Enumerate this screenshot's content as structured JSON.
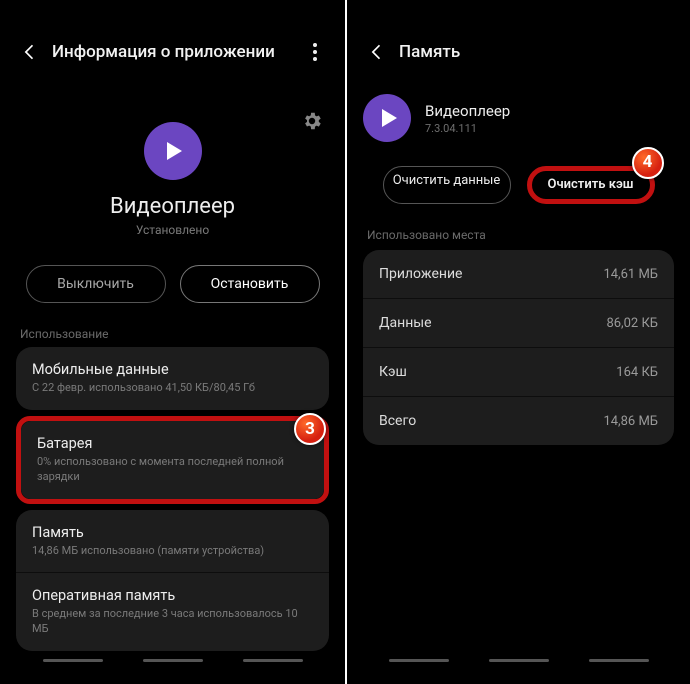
{
  "left": {
    "header_title": "Информация о приложении",
    "app_name": "Видеоплеер",
    "app_status": "Установлено",
    "btn_disable": "Выключить",
    "btn_stop": "Остановить",
    "section_usage": "Использование",
    "items": [
      {
        "title": "Мобильные данные",
        "sub": "С 22 февр. использовано 41,50 КБ/80,45 Гб"
      },
      {
        "title": "Батарея",
        "sub": "0% использовано с момента последней полной зарядки"
      },
      {
        "title": "Память",
        "sub": "14,86 МБ использовано (памяти устройства)"
      },
      {
        "title": "Оперативная память",
        "sub": "В среднем за последние 3 часа использовалось 10 МБ"
      }
    ],
    "badge": "3"
  },
  "right": {
    "header_title": "Память",
    "app_name": "Видеоплеер",
    "app_version": "7.3.04.111",
    "btn_clear_data": "Очистить данные",
    "btn_clear_cache": "Очистить кэш",
    "section_used": "Использовано места",
    "rows": [
      {
        "label": "Приложение",
        "value": "14,61 МБ"
      },
      {
        "label": "Данные",
        "value": "86,02 КБ"
      },
      {
        "label": "Кэш",
        "value": "164 КБ"
      },
      {
        "label": "Всего",
        "value": "14,86 МБ"
      }
    ],
    "badge": "4"
  }
}
